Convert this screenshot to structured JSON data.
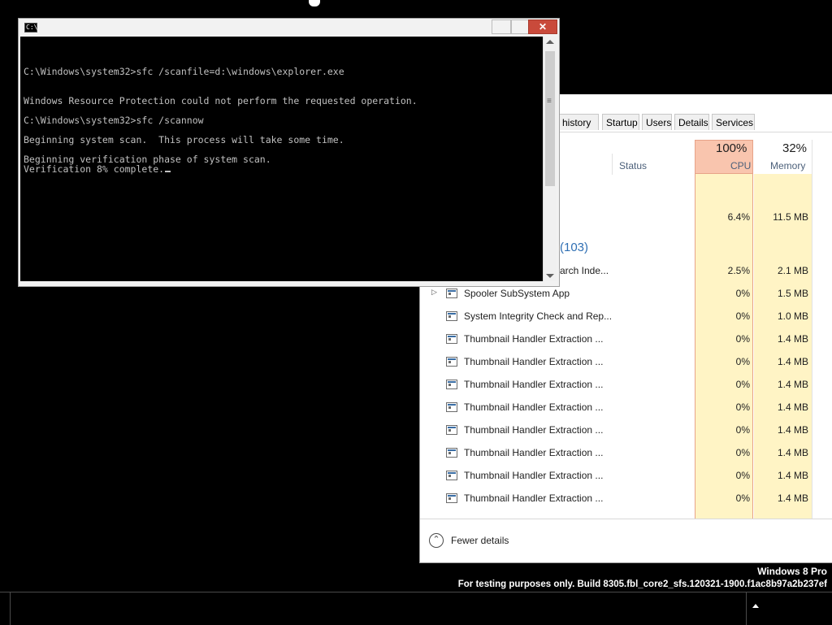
{
  "taskmgr": {
    "tabs": [
      "p history",
      "Startup",
      "Users",
      "Details",
      "Services"
    ],
    "columns": {
      "status": "Status",
      "cpu_pct": "100%",
      "cpu_label": "CPU",
      "mem_pct": "32%",
      "mem_label": "Memory"
    },
    "group_row": {
      "cpu": "6.4%",
      "mem": "11.5 MB"
    },
    "group_label": "(103)",
    "rows": [
      {
        "name": "arch Inde...",
        "cpu": "2.5%",
        "mem": "2.1 MB"
      },
      {
        "name": "Spooler SubSystem App",
        "cpu": "0%",
        "mem": "1.5 MB"
      },
      {
        "name": "System Integrity Check and Rep...",
        "cpu": "0%",
        "mem": "1.0 MB"
      },
      {
        "name": "Thumbnail Handler Extraction ...",
        "cpu": "0%",
        "mem": "1.4 MB"
      },
      {
        "name": "Thumbnail Handler Extraction ...",
        "cpu": "0%",
        "mem": "1.4 MB"
      },
      {
        "name": "Thumbnail Handler Extraction ...",
        "cpu": "0%",
        "mem": "1.4 MB"
      },
      {
        "name": "Thumbnail Handler Extraction ...",
        "cpu": "0%",
        "mem": "1.4 MB"
      },
      {
        "name": "Thumbnail Handler Extraction ...",
        "cpu": "0%",
        "mem": "1.4 MB"
      },
      {
        "name": "Thumbnail Handler Extraction ...",
        "cpu": "0%",
        "mem": "1.4 MB"
      },
      {
        "name": "Thumbnail Handler Extraction ...",
        "cpu": "0%",
        "mem": "1.4 MB"
      },
      {
        "name": "Thumbnail Handler Extraction ...",
        "cpu": "0%",
        "mem": "1.4 MB"
      }
    ],
    "fewer_details": "Fewer details"
  },
  "cmd": {
    "lines": [
      "C:\\Windows\\system32>sfc /scanfile=d:\\windows\\explorer.exe",
      "Windows Resource Protection could not perform the requested operation.",
      "C:\\Windows\\system32>sfc /scannow",
      "Beginning system scan.  This process will take some time.",
      "Beginning verification phase of system scan.",
      "Verification 8% complete."
    ],
    "icon_text": "C:\\",
    "close_glyph": "✕"
  },
  "watermark": {
    "os": "Windows 8 Pro",
    "build": "For testing purposes only. Build 8305.fbl_core2_sfs.120321-1900.f1ac8b97a2b237ef"
  },
  "icons": {
    "expand": "chevron-right-icon",
    "collapse": "chevron-up-circle-icon",
    "tray": "tray-overflow-icon"
  }
}
